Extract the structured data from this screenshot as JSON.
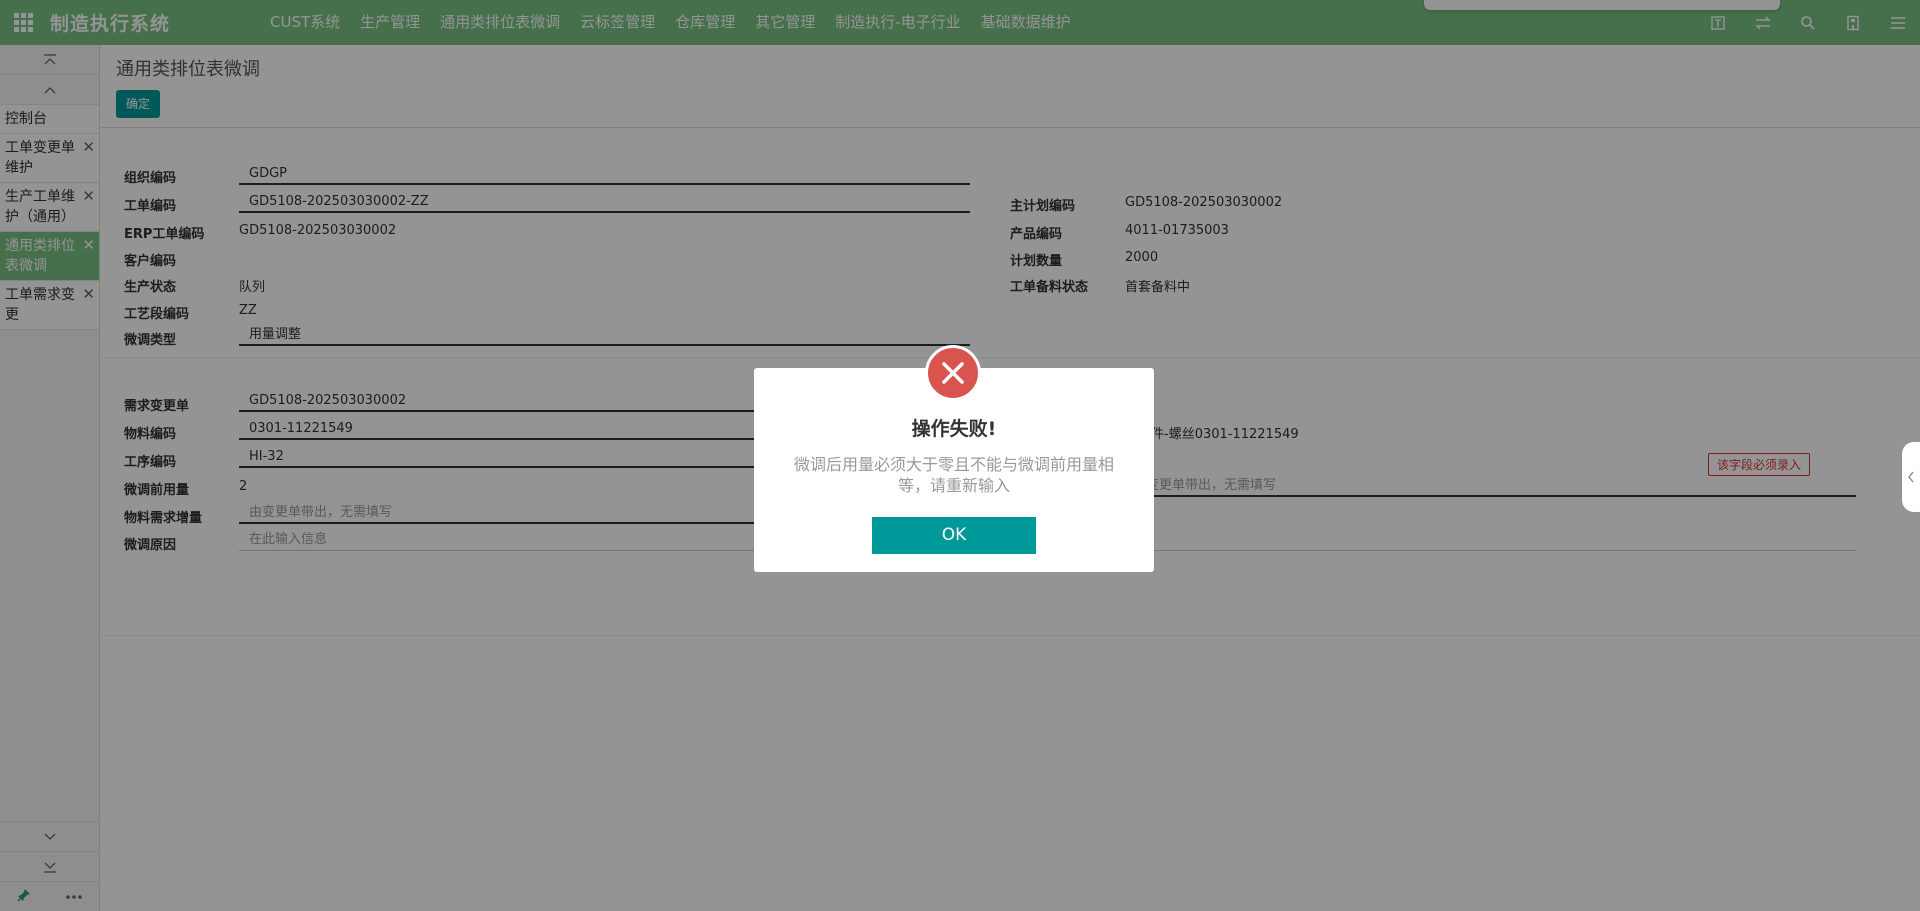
{
  "app": {
    "title": "制造执行系统"
  },
  "menu": [
    "CUST系统",
    "生产管理",
    "通用类排位表微调",
    "云标签管理",
    "仓库管理",
    "其它管理",
    "制造执行-电子行业",
    "基础数据维护"
  ],
  "sidebar": {
    "items": [
      {
        "label": "控制台",
        "closable": false,
        "active": false
      },
      {
        "label": "工单变更单维护",
        "closable": true,
        "active": false
      },
      {
        "label": "生产工单维护（通用）",
        "closable": true,
        "active": false
      },
      {
        "label": "通用类排位表微调",
        "closable": true,
        "active": true
      },
      {
        "label": "工单需求变更",
        "closable": true,
        "active": false
      }
    ]
  },
  "page": {
    "title": "通用类排位表微调",
    "confirm_label": "确定"
  },
  "form1": {
    "org_code_label": "组织编码",
    "org_code": "GDGP",
    "wo_code_label": "工单编码",
    "wo_code": "GD5108-202503030002-ZZ",
    "erp_wo_label": "ERP工单编码",
    "erp_wo": "GD5108-202503030002",
    "customer_label": "客户编码",
    "prod_status_label": "生产状态",
    "prod_status": "队列",
    "process_seg_label": "工艺段编码",
    "process_seg": "ZZ",
    "adjust_type_label": "微调类型",
    "adjust_type": "用量调整",
    "master_plan_label": "主计划编码",
    "master_plan": "GD5108-202503030002",
    "product_code_label": "产品编码",
    "product_code": "4011-01735003",
    "plan_qty_label": "计划数量",
    "plan_qty": "2000",
    "material_status_label": "工单备料状态",
    "material_status": "首套备料中"
  },
  "form2": {
    "req_change_label": "需求变更单",
    "req_change": "GD5108-202503030002",
    "material_code_label": "物料编码",
    "material_code": "0301-11221549",
    "operation_code_label": "工序编码",
    "operation_code": "HI-32",
    "before_qty_label": "微调前用量",
    "before_qty": "2",
    "req_increase_label": "物料需求增量",
    "req_increase_placeholder": "由变更单带出，无需填写",
    "reason_label": "微调原因",
    "reason_placeholder": "在此输入信息",
    "material_desc_partial": "件-螺丝0301-11221549",
    "right_placeholder_partial": "变更单带出，无需填写",
    "required_tip": "该字段必须录入"
  },
  "dialog": {
    "title": "操作失败!",
    "message": "微调后用量必须大于零且不能与微调前用量相等，请重新输入",
    "ok_label": "OK"
  }
}
